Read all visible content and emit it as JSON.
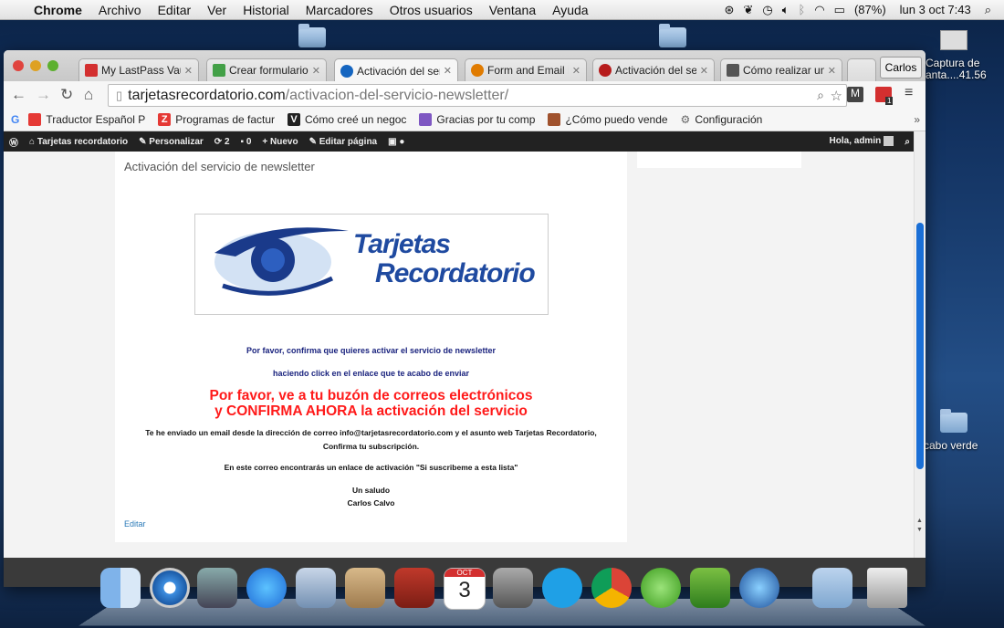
{
  "menubar": {
    "app": "Chrome",
    "items": [
      "Archivo",
      "Editar",
      "Ver",
      "Historial",
      "Marcadores",
      "Otros usuarios",
      "Ventana",
      "Ayuda"
    ],
    "battery": "(87%)",
    "clock": "lun 3 oct  7:43"
  },
  "desktop": {
    "capture_label_1": "Captura de",
    "capture_label_2": "anta....41.56",
    "folder_label": "cabo verde"
  },
  "browser": {
    "tabs": [
      {
        "label": "My LastPass Vault",
        "color": "#d32f2f"
      },
      {
        "label": "Crear formulario f",
        "color": "#43a047"
      },
      {
        "label": "Activación del ser",
        "color": "#1565c0"
      },
      {
        "label": "Form and Email D",
        "color": "#e07b00"
      },
      {
        "label": "Activación del ser",
        "color": "#b71c1c"
      },
      {
        "label": "Cómo realizar una",
        "color": "#555555"
      }
    ],
    "profile": "Carlos",
    "url_host": "tarjetasrecordatorio.com",
    "url_path": "/activacion-del-servicio-newsletter/",
    "ext_badge": "1",
    "bookmarks": [
      {
        "label": "Traductor Español P",
        "color": "#e53935"
      },
      {
        "label": "Programas de factur",
        "color": "#e53935"
      },
      {
        "label": "Cómo creé un negoc",
        "color": "#222222"
      },
      {
        "label": "Gracias por tu comp",
        "color": "#7e57c2"
      },
      {
        "label": "¿Cómo puedo vende",
        "color": "#a0522d"
      },
      {
        "label": "Configuración",
        "color": "#666666"
      }
    ],
    "bookmarks_more": "»"
  },
  "adminbar": {
    "site": "Tarjetas recordatorio",
    "customize": "Personalizar",
    "updates": "2",
    "comments": "0",
    "new": "+ Nuevo",
    "edit": "Editar página",
    "greeting": "Hola, admin"
  },
  "page": {
    "title": "Activación del servicio de newsletter",
    "logo_line1": "Tarjetas",
    "logo_line2": "Recordatorio",
    "confirm_1": "Por favor, confirma que quieres activar el servicio de newsletter",
    "confirm_2": "haciendo click en el enlace que te acabo de enviar",
    "alert_1": "Por favor, ve a tu buzón de correos electrónicos",
    "alert_2": "y CONFIRMA AHORA la activación del servicio",
    "email_1": "Te he enviado un email desde la dirección de correo info@tarjetasrecordatorio.com y el asunto web Tarjetas Recordatorio,",
    "email_2": "Confirma tu subscripción.",
    "link_text": "En este correo encontrarás un enlace de activación \"Si suscribeme a esta lista\"",
    "greeting": "Un saludo",
    "signature": "Carlos Calvo",
    "edit_link": "Editar"
  },
  "dock": {
    "calendar_month": "OCT",
    "calendar_day": "3"
  }
}
